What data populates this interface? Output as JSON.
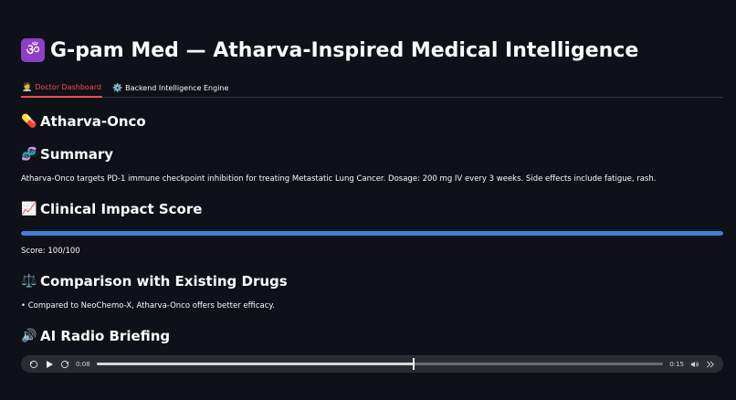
{
  "app": {
    "title": "G-pam Med — Atharva-Inspired Medical Intelligence",
    "title_icon": "om-symbol-icon",
    "title_icon_glyph": "ॐ"
  },
  "tabs": [
    {
      "label": "Doctor Dashboard",
      "icon": "doctor-icon",
      "glyph": "🧑‍⚕️",
      "active": true
    },
    {
      "label": "Backend Intelligence Engine",
      "icon": "gear-icon",
      "glyph": "⚙️",
      "active": false
    }
  ],
  "drug": {
    "name": "Atharva-Onco",
    "icon": "pill-icon",
    "glyph": "💊"
  },
  "summary": {
    "heading": "Summary",
    "icon": "dna-icon",
    "glyph": "🧬",
    "text": "Atharva-Onco targets PD-1 immune checkpoint inhibition for treating Metastatic Lung Cancer. Dosage: 200 mg IV every 3 weeks. Side effects include fatigue, rash."
  },
  "impact": {
    "heading": "Clinical Impact Score",
    "icon": "chart-increasing-icon",
    "glyph": "📈",
    "progress_fraction": 1.0,
    "score_text": "Score: 100/100",
    "bar_color": "#3d7fd9"
  },
  "comparison": {
    "heading": "Comparison with Existing Drugs",
    "icon": "balance-scale-icon",
    "glyph": "⚖️",
    "items": [
      "• Compared to NeoChemo-X, Atharva-Onco offers better efficacy."
    ]
  },
  "radio": {
    "heading": "AI Radio Briefing",
    "icon": "speaker-icon",
    "glyph": "🔊"
  },
  "audio_player": {
    "current_time": "0:08",
    "duration": "0:15",
    "progress_fraction": 0.56
  },
  "colors": {
    "background": "#0e1117",
    "accent_tab": "#ff4b4b",
    "om_badge": "#8e3fc6"
  }
}
